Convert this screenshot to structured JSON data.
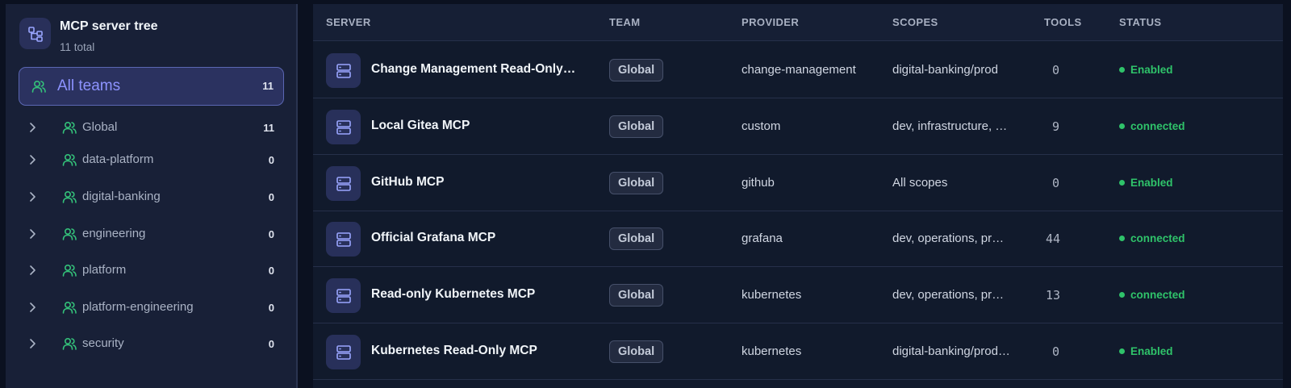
{
  "sidebar": {
    "title": "MCP server tree",
    "total": "11 total",
    "all_teams": {
      "label": "All teams",
      "count": "11"
    },
    "teams": [
      {
        "label": "Global",
        "count": "11"
      },
      {
        "label": "data-platform",
        "count": "0"
      },
      {
        "label": "digital-banking",
        "count": "0"
      },
      {
        "label": "engineering",
        "count": "0"
      },
      {
        "label": "platform",
        "count": "0"
      },
      {
        "label": "platform-engineering",
        "count": "0"
      },
      {
        "label": "security",
        "count": "0"
      }
    ]
  },
  "table": {
    "headers": {
      "server": "SERVER",
      "team": "TEAM",
      "provider": "PROVIDER",
      "scopes": "SCOPES",
      "tools": "TOOLS",
      "status": "STATUS"
    },
    "rows": [
      {
        "server": "Change Management Read-Only…",
        "team": "Global",
        "provider": "change-management",
        "scopes": "digital-banking/prod",
        "tools": "0",
        "status": "Enabled"
      },
      {
        "server": "Local Gitea MCP",
        "team": "Global",
        "provider": "custom",
        "scopes": "dev, infrastructure, …",
        "tools": "9",
        "status": "connected"
      },
      {
        "server": "GitHub MCP",
        "team": "Global",
        "provider": "github",
        "scopes": "All scopes",
        "tools": "0",
        "status": "Enabled"
      },
      {
        "server": "Official Grafana MCP",
        "team": "Global",
        "provider": "grafana",
        "scopes": "dev, operations, pr…",
        "tools": "44",
        "status": "connected"
      },
      {
        "server": "Read-only Kubernetes MCP",
        "team": "Global",
        "provider": "kubernetes",
        "scopes": "dev, operations, pr…",
        "tools": "13",
        "status": "connected"
      },
      {
        "server": "Kubernetes Read-Only MCP",
        "team": "Global",
        "provider": "kubernetes",
        "scopes": "digital-banking/prod…",
        "tools": "0",
        "status": "Enabled"
      }
    ]
  },
  "icons": {
    "tree": "tree-structure-icon",
    "team": "users-icon",
    "chevron": "chevron-right-icon",
    "server": "server-icon",
    "status": "status-dot-icon"
  },
  "colors": {
    "accent": "#8d93ff",
    "team_icon": "#34c27a",
    "status_green": "#2fc36a",
    "background": "#0b1120",
    "sidebar": "#182037"
  }
}
